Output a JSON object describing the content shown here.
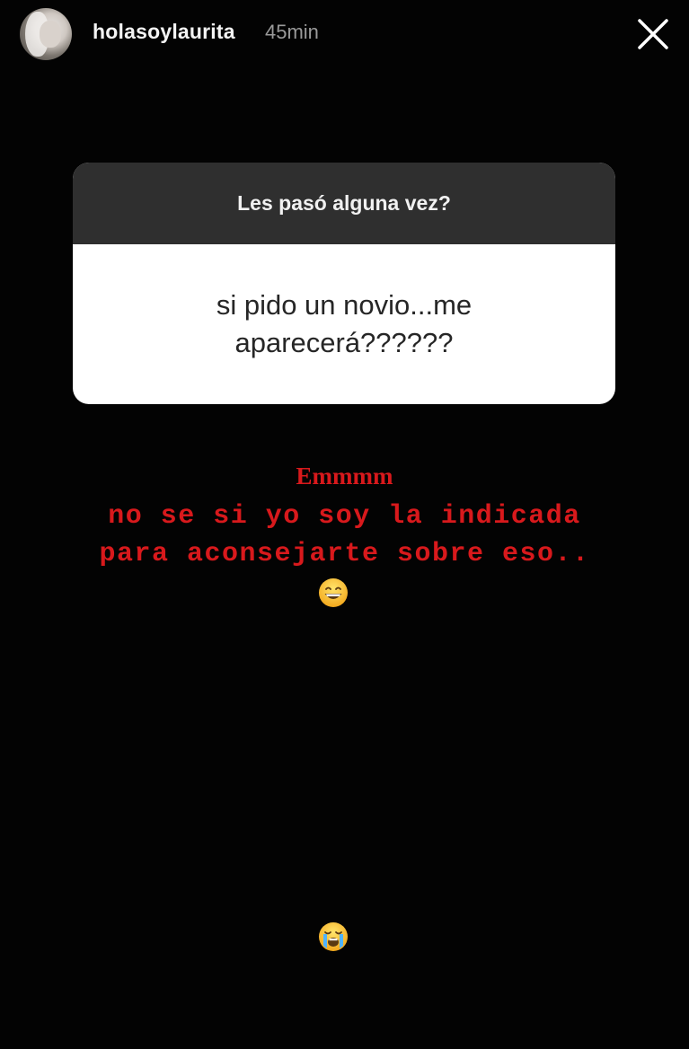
{
  "header": {
    "username": "holasoylaurita",
    "time_ago": "45min"
  },
  "question_sticker": {
    "prompt": "Les pasó alguna vez?",
    "answer": "si pido un novio...me aparecerá??????"
  },
  "reply_text": {
    "line_emm": "Emmmm",
    "line_1": "no se si yo soy la indicada",
    "line_2": "para aconsejarte sobre eso.."
  },
  "emojis": {
    "first": "grinning-face-emoji",
    "second": "loudly-crying-face-emoji"
  },
  "colors": {
    "background": "#030303",
    "reply_red": "#d8191c",
    "sticker_header": "#2f2f2f"
  }
}
